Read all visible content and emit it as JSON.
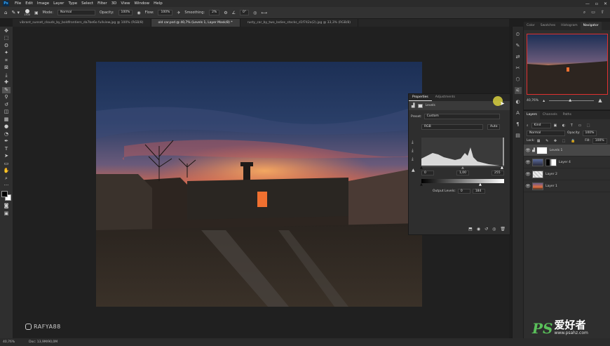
{
  "menubar": {
    "app": "Ps",
    "items": [
      "File",
      "Edit",
      "Image",
      "Layer",
      "Type",
      "Select",
      "Filter",
      "3D",
      "View",
      "Window",
      "Help"
    ]
  },
  "options": {
    "brush_size": "1300",
    "mode_label": "Mode:",
    "mode_value": "Normal",
    "opacity_label": "Opacity:",
    "opacity_value": "100%",
    "flow_label": "Flow:",
    "flow_value": "100%",
    "smoothing_label": "Smoothing:",
    "smoothing_value": "2%",
    "angle_value": "0°"
  },
  "tabs": [
    {
      "label": "vibrant_sunset_clouds_by_boldfrontiers_da7be6o fullview.jpg @ 100% (RGB/8)"
    },
    {
      "label": "old car.psd @ 40,7% (Levels 1, Layer Mask/8) *"
    },
    {
      "label": "rusty_car_by_two_ladies_stocks_d1f742a(2).jpg @ 33,3% (RGB/8)"
    }
  ],
  "properties": {
    "tab_properties": "Properties",
    "tab_adjustments": "Adjustments",
    "title": "Levels",
    "preset_label": "Preset:",
    "preset_value": "Custom",
    "channel": "RGB",
    "auto": "Auto",
    "input_black": "0",
    "input_gamma": "1,00",
    "input_white": "255",
    "output_label": "Output Levels:",
    "output_black": "0",
    "output_white": "184"
  },
  "navigator": {
    "tabs": [
      "Color",
      "Swatches",
      "Histogram",
      "Navigator"
    ],
    "zoom": "40,76%"
  },
  "layers": {
    "tabs": [
      "Layers",
      "Channels",
      "Paths"
    ],
    "kind": "Kind",
    "blend": "Normal",
    "opacity_label": "Opacity:",
    "opacity": "100%",
    "lock_label": "Lock:",
    "fill_label": "Fill:",
    "fill": "100%",
    "items": [
      {
        "name": "Levels 1",
        "selected": true,
        "thumb": "#dddddd"
      },
      {
        "name": "Layer 4",
        "selected": false,
        "thumb": "#3a4a6a"
      },
      {
        "name": "Layer 2",
        "selected": false,
        "thumb": "#e8d8d0"
      },
      {
        "name": "Layer 1",
        "selected": false,
        "thumb": "#c06040"
      }
    ]
  },
  "status": {
    "zoom": "40,76%",
    "doc": "Doc: 13,9M/90,0M"
  },
  "watermark": {
    "handle": "RAFYA88"
  },
  "brand": {
    "ps": "PS",
    "chinese": "爱好者",
    "url": "www.psahz.com"
  },
  "colors": {
    "accent": "#31a8ff",
    "panel": "#2e2e2e",
    "canvas": "#202020"
  }
}
